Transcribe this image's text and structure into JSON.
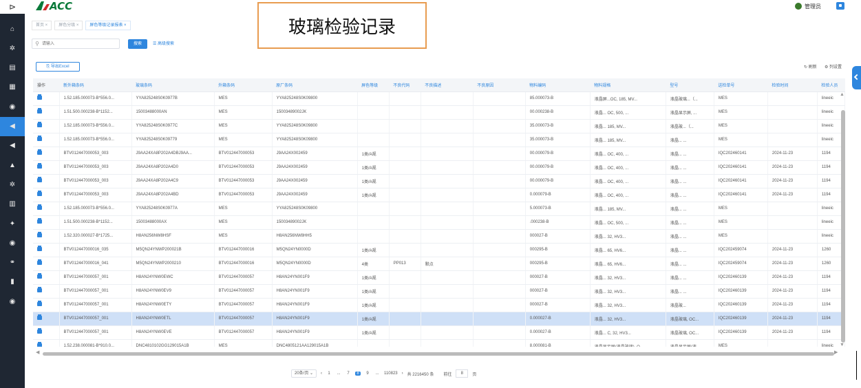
{
  "callout_title": "玻璃检验记录",
  "topbar": {
    "toggle_icon": "collapse-icon",
    "logo_text": "ACC",
    "user_label": "管理员"
  },
  "sidebar": {
    "icons": [
      "home-icon",
      "gear-icon",
      "clipboard-icon",
      "chart-icon",
      "settings-circle-icon",
      "bell-icon",
      "bell-icon",
      "building-icon",
      "gear-icon",
      "table-icon",
      "users-icon",
      "settings-circle-icon",
      "link-icon",
      "book-icon",
      "settings-circle-icon"
    ],
    "active_index": 5
  },
  "tabs": [
    {
      "label": "首页"
    },
    {
      "label": "屏色分级"
    },
    {
      "label": "屏色等级记录报表"
    }
  ],
  "search": {
    "placeholder": "请输入",
    "button_label": "搜索",
    "advanced_label": "高级搜索"
  },
  "toolbar": {
    "export_label": "导出Excel",
    "refresh_label": "刷新",
    "column_settings_label": "列设置"
  },
  "table": {
    "headers": [
      "操作",
      "新外箱条码",
      "玻璃条码",
      "外箱条码",
      "原厂条码",
      "屏色等级",
      "不良代码",
      "不良描述",
      "不良原因",
      "物料编码",
      "物料规格",
      "型号",
      "送检单号",
      "检验时间",
      "检验人员"
    ],
    "selected_row": 16,
    "rows": [
      [
        "",
        "1.52.185.000073-B*556.0...",
        "YYA825248S0K0977B",
        "MES",
        "YYA825248S0K09800",
        "",
        "",
        "",
        "",
        "85.000073-B",
        "液晶屏...OC, 185, MV...",
        "液晶玻璃...（...",
        "MES",
        "",
        "lineeic"
      ],
      [
        "",
        "1.51.500.000238-B*1152...",
        "15003488000AN",
        "MES",
        "15003489002JK",
        "",
        "",
        "",
        "",
        "00.000238-B",
        "液晶... OC, 500, ...",
        "液晶显示屏, ...",
        "MES",
        "",
        "lineeic"
      ],
      [
        "",
        "1.52.185.000073-B*556.0...",
        "YYA825248S0K0977C",
        "MES",
        "YYA825248S0K09800",
        "",
        "",
        "",
        "",
        "35.000073-B",
        "液晶... 185, MV...",
        "液晶玻...（...",
        "MES",
        "",
        "lineeic"
      ],
      [
        "",
        "1.52.185.000073-B*556.0...",
        "YYA825248S0K09779",
        "MES",
        "YYA825248S0K09800",
        "",
        "",
        "",
        "",
        "35.000073-B",
        "液晶... 185, MV...",
        "液晶... ...",
        "MES",
        "",
        "lineeic"
      ],
      [
        "",
        "BTV012447000053_003",
        "J9AA24XA8P202A4DBJ9AA...",
        "BTV012447000053",
        "J9AA24X002459",
        "1类/A规",
        "",
        "",
        "",
        "00.000079-B",
        "液晶... OC, 400, ...",
        "液晶... ...",
        "IQC202460141",
        "2024-11-23",
        "1194"
      ],
      [
        "",
        "BTV012447000053_003",
        "J9AA24XA8P202A4D0",
        "BTV012447000053",
        "J9AA24X002459",
        "1类/A规",
        "",
        "",
        "",
        "00.000079-B",
        "液晶... OC, 400, ...",
        "液晶... ...",
        "IQC202460141",
        "2024-11-23",
        "1194"
      ],
      [
        "",
        "BTV012447000053_003",
        "J9AA24XA8P202A4C9",
        "BTV012447000053",
        "J9AA24X002459",
        "1类/A规",
        "",
        "",
        "",
        "00.000079-B",
        "液晶... OC, 400, ...",
        "液晶... ...",
        "IQC202460141",
        "2024-11-23",
        "1194"
      ],
      [
        "",
        "BTV012447000053_003",
        "J9AA24XA8P202A4BD",
        "BTV012447000053",
        "J9AA24X002459",
        "1类/A规",
        "",
        "",
        "",
        "0.000079-B",
        "液晶... OC, 400, ...",
        "液晶... ...",
        "IQC202460141",
        "2024-11-23",
        "1194"
      ],
      [
        "",
        "1.52.185.000073-B*556.0...",
        "YYA825248S0K0977A",
        "MES",
        "YYA825248S0K09800",
        "",
        "",
        "",
        "",
        "5.000073-B",
        "液晶... 185, MV...",
        "液晶... ...",
        "MES",
        "",
        "lineeic"
      ],
      [
        "",
        "1.51.500.000238-B*1152...",
        "15003488000AX",
        "MES",
        "15003489002JK",
        "",
        "",
        "",
        "",
        ".000238-B",
        "液晶... OC, 500, ...",
        "液晶... ...",
        "MES",
        "",
        "lineeic"
      ],
      [
        "",
        "1.52.320.000027-B*1725...",
        "H8AN256NW8HSF",
        "MES",
        "H8AN256NW8HH5",
        "",
        "",
        "",
        "",
        "000027-B",
        "液晶... 32, HV3...",
        "液晶... ...",
        "MES",
        "",
        "lineeic"
      ],
      [
        "",
        "BTV012447000016_035",
        "M5QN24YNWP200021B",
        "BTV012447000016",
        "M5QN24YN0000D",
        "1类/A规",
        "",
        "",
        "",
        "000295-B",
        "液晶... 65, HV6...",
        "液晶... ...",
        "IQC202459074",
        "2024-11-23",
        "1260"
      ],
      [
        "",
        "BTV012447000016_041",
        "M5QN24YNWP2000210",
        "BTV012447000016",
        "M5QN24YN0000D",
        "4类",
        "PP013",
        "默点",
        "",
        "000295-B",
        "液晶... 65, HV6...",
        "液晶... ...",
        "IQC202459074",
        "2024-11-23",
        "1260"
      ],
      [
        "",
        "BTV012447000057_001",
        "H8AN24YNW0EWC",
        "BTV012447000057",
        "H8AN24YN001F9",
        "1类/A规",
        "",
        "",
        "",
        "000027-B",
        "液晶... 32, HV3...",
        "液晶... ...",
        "IQC202460139",
        "2024-11-23",
        "1194"
      ],
      [
        "",
        "BTV012447000057_001",
        "H8AN24YNW0EV9",
        "BTV012447000057",
        "H8AN24YN001F9",
        "1类/A规",
        "",
        "",
        "",
        "000027-B",
        "液晶... 32, HV3...",
        "液晶... ...",
        "IQC202460139",
        "2024-11-23",
        "1194"
      ],
      [
        "",
        "BTV012447000057_001",
        "H8AN24YNW0ETY",
        "BTV012447000057",
        "H8AN24YN001F9",
        "1类/A规",
        "",
        "",
        "",
        "000027-B",
        "液晶... 32, HV3...",
        "液晶玻...",
        "IQC202460139",
        "2024-11-23",
        "1194"
      ],
      [
        "",
        "BTV012447000057_001",
        "H8AN24YNW0ETL",
        "BTV012447000057",
        "H8AN24YN001F9",
        "1类/A规",
        "",
        "",
        "",
        "0.000027-B",
        "液晶... 32, HV3...",
        "液晶玻璃, OC...",
        "IQC202460139",
        "2024-11-23",
        "1194"
      ],
      [
        "",
        "BTV012447000057_001",
        "H8AN24YNW0EVE",
        "BTV012447000057",
        "H8AN24YN001F9",
        "1类/A规",
        "",
        "",
        "",
        "0.000027-B",
        "液晶... C, 32, HV3...",
        "液晶玻璃, OC...",
        "IQC202460139",
        "2024-11-23",
        "1194"
      ],
      [
        "",
        "1.52.238.000081-B*910.0...",
        "DNC4810102GG129015A1B",
        "MES",
        "DNC4805121AA129015A1B",
        "",
        "",
        "",
        "",
        "8.000081-B",
        "液晶显示屏(液晶玻璃), O...",
        "液晶显示屏(液...",
        "MES",
        "",
        "lineeic"
      ]
    ]
  },
  "pagination": {
    "page_size": "20条/页",
    "pages": [
      "1",
      "...",
      "7",
      "8",
      "9",
      "...",
      "110823"
    ],
    "active_page": "8",
    "total": "共 2216450 条",
    "goto_label": "前往",
    "goto_value": "8",
    "page_unit": "页"
  },
  "colors": {
    "accent": "#2e86de",
    "sidebar_bg": "#1f2733",
    "callout_border": "#e89b4f"
  }
}
